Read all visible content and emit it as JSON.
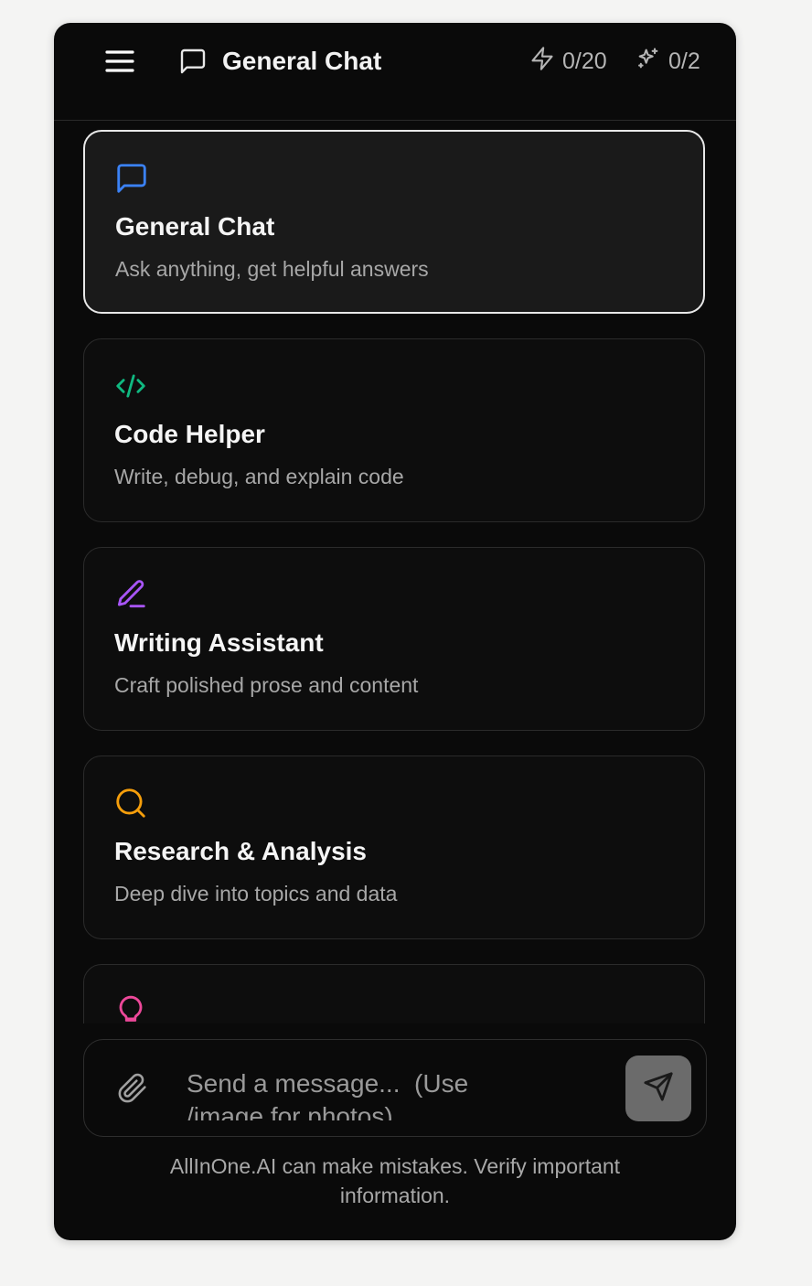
{
  "header": {
    "title": "General Chat",
    "menu_icon": "hamburger-menu-icon",
    "chat_icon": "message-square-icon",
    "quota_fast": {
      "icon": "lightning-bolt-icon",
      "label": "0/20"
    },
    "quota_pro": {
      "icon": "sparkles-icon",
      "label": "0/2"
    }
  },
  "modes": [
    {
      "title": "General Chat",
      "description": "Ask anything, get helpful answers",
      "icon": "message-square-icon",
      "color": "#3b82f6",
      "selected": true
    },
    {
      "title": "Code Helper",
      "description": "Write, debug, and explain code",
      "icon": "code-brackets-icon",
      "color": "#10b981",
      "selected": false
    },
    {
      "title": "Writing Assistant",
      "description": "Craft polished prose and content",
      "icon": "pen-icon",
      "color": "#a855f7",
      "selected": false
    },
    {
      "title": "Research & Analysis",
      "description": "Deep dive into topics and data",
      "icon": "magnifier-icon",
      "color": "#f59e0b",
      "selected": false
    },
    {
      "icon": "lightbulb-icon",
      "color": "#ec4899",
      "selected": false
    }
  ],
  "composer": {
    "placeholder": "Send a message...  (Use /image for photos)",
    "value": "",
    "attach_icon": "paperclip-icon",
    "send_icon": "send-icon"
  },
  "disclaimer": "AllInOne.AI can make mistakes. Verify important information."
}
